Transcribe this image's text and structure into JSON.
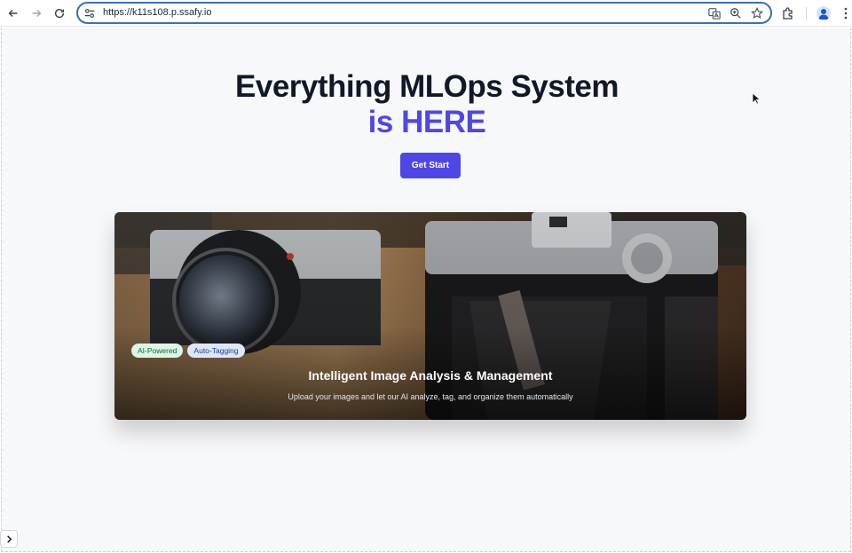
{
  "browser": {
    "url": "https://k11s108.p.ssafy.io"
  },
  "hero": {
    "title": "Everything MLOps System",
    "subtitle": "is HERE",
    "cta_label": "Get Start"
  },
  "card": {
    "badges": [
      "AI-Powered",
      "Auto-Tagging"
    ],
    "title": "Intelligent Image Analysis & Management",
    "description": "Upload your images and let our AI analyze, tag, and organize them automatically"
  },
  "colors": {
    "accent": "#4f46e5",
    "heading": "#111827",
    "page_bg": "#f7f8fa"
  }
}
